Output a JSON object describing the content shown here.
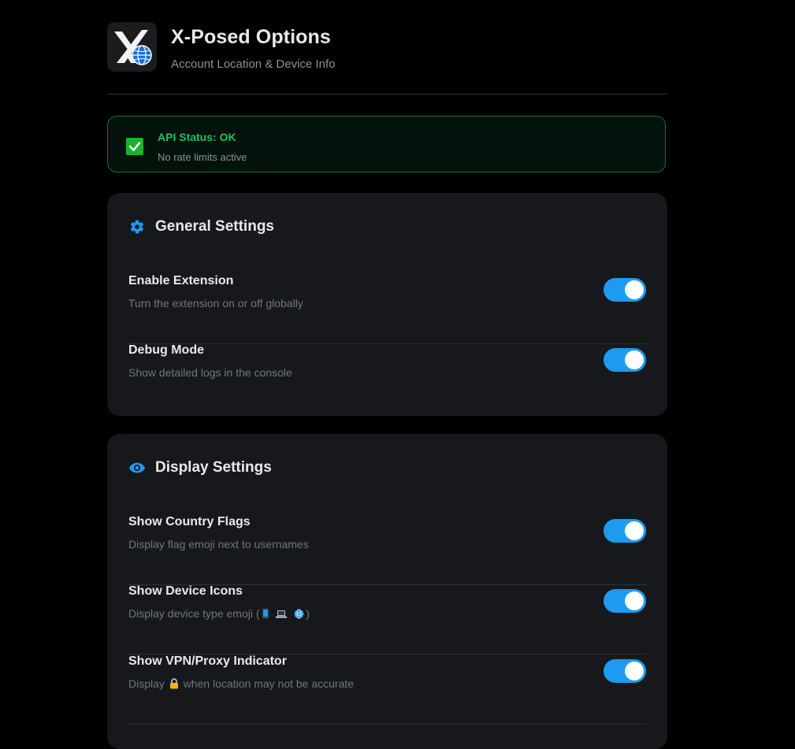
{
  "header": {
    "title": "X-Posed Options",
    "subtitle": "Account Location & Device Info",
    "logo_icon": "x-globe-logo-icon"
  },
  "api_status": {
    "title": "API Status: OK",
    "subtitle": "No rate limits active",
    "icon": "check-icon",
    "color": "#22c05e"
  },
  "general_settings": {
    "title": "General Settings",
    "icon": "gear-icon",
    "items": [
      {
        "label": "Enable Extension",
        "description": "Turn the extension on or off globally",
        "enabled": true
      },
      {
        "label": "Debug Mode",
        "description": "Show detailed logs in the console",
        "enabled": true
      }
    ]
  },
  "display_settings": {
    "title": "Display Settings",
    "icon": "eye-icon",
    "items": [
      {
        "label": "Show Country Flags",
        "description": "Display flag emoji next to usernames",
        "enabled": true
      },
      {
        "label": "Show Device Icons",
        "description_prefix": "Display device type emoji (",
        "description_suffix": ")",
        "description_icons": [
          "phone-icon",
          "laptop-icon",
          "globe-icon"
        ],
        "enabled": true
      },
      {
        "label": "Show VPN/Proxy Indicator",
        "description_prefix": "Display",
        "description_suffix": "when location may not be accurate",
        "description_icons": [
          "lock-icon"
        ],
        "enabled": true
      }
    ]
  },
  "colors": {
    "accent": "#1d9bf0",
    "card_background": "#16181c",
    "page_background": "#000000",
    "status_ok": "#22c05e"
  }
}
